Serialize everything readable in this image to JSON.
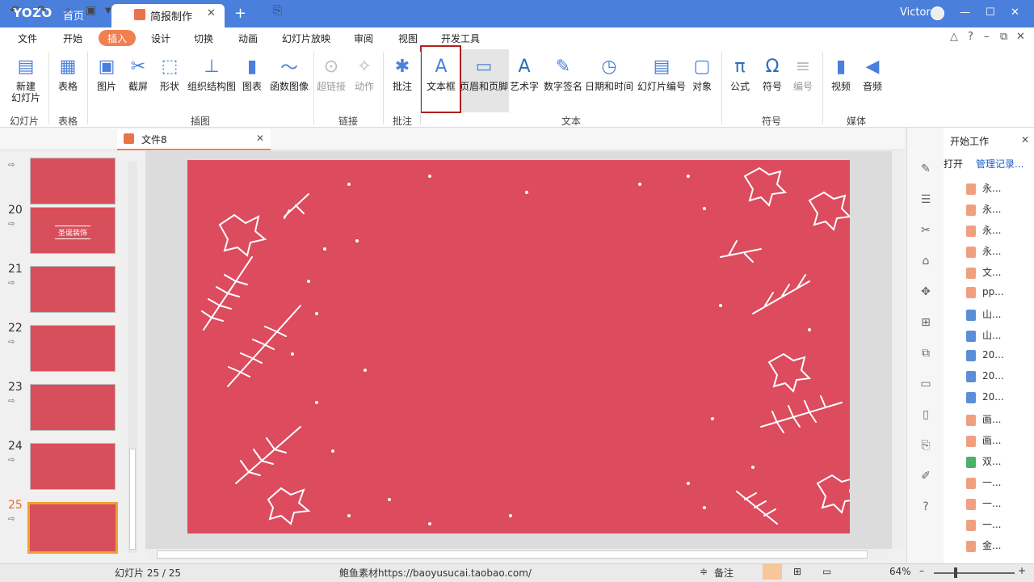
{
  "titlebar": {
    "logo": "YOZO",
    "home": "首页",
    "doc_tab": "简报制作",
    "user": "Victor"
  },
  "menu": [
    "文件",
    "开始",
    "插入",
    "设计",
    "切换",
    "动画",
    "幻灯片放映",
    "审阅",
    "视图",
    "开发工具"
  ],
  "menu_active": "插入",
  "ribbon": {
    "buttons": [
      {
        "label": "新建\n幻灯片",
        "icon": "new-slide-icon",
        "disabled": false
      },
      {
        "label": "表格",
        "icon": "table-icon",
        "disabled": false
      },
      {
        "label": "图片",
        "icon": "picture-icon",
        "disabled": false
      },
      {
        "label": "截屏",
        "icon": "screenshot-icon",
        "disabled": false
      },
      {
        "label": "形状",
        "icon": "shapes-icon",
        "disabled": false
      },
      {
        "label": "组织结构图",
        "icon": "org-chart-icon",
        "disabled": false
      },
      {
        "label": "图表",
        "icon": "chart-icon",
        "disabled": false
      },
      {
        "label": "函数图像",
        "icon": "function-graph-icon",
        "disabled": false
      },
      {
        "label": "超链接",
        "icon": "hyperlink-icon",
        "disabled": true
      },
      {
        "label": "动作",
        "icon": "action-icon",
        "disabled": true
      },
      {
        "label": "批注",
        "icon": "comment-icon",
        "disabled": false
      },
      {
        "label": "文本框",
        "icon": "textbox-icon",
        "disabled": false
      },
      {
        "label": "页眉和页脚",
        "icon": "header-footer-icon",
        "disabled": false
      },
      {
        "label": "艺术字",
        "icon": "wordart-icon",
        "disabled": false
      },
      {
        "label": "数字签名",
        "icon": "signature-icon",
        "disabled": false
      },
      {
        "label": "日期和时间",
        "icon": "datetime-icon",
        "disabled": false
      },
      {
        "label": "幻灯片编号",
        "icon": "slide-number-icon",
        "disabled": false
      },
      {
        "label": "对象",
        "icon": "object-icon",
        "disabled": false
      },
      {
        "label": "公式",
        "icon": "formula-icon",
        "disabled": false
      },
      {
        "label": "符号",
        "icon": "symbol-icon",
        "disabled": false
      },
      {
        "label": "编号",
        "icon": "numbering-icon",
        "disabled": true
      },
      {
        "label": "视频",
        "icon": "video-icon",
        "disabled": false
      },
      {
        "label": "音频",
        "icon": "audio-icon",
        "disabled": false
      }
    ],
    "groups": [
      "幻灯片",
      "表格",
      "插图",
      "链接",
      "批注",
      "文本",
      "符号",
      "媒体"
    ]
  },
  "file_tab": "文件8",
  "thumbnails": [
    {
      "num": "",
      "title": ""
    },
    {
      "num": "20",
      "title": "圣诞装饰"
    },
    {
      "num": "21",
      "title": ""
    },
    {
      "num": "22",
      "title": ""
    },
    {
      "num": "23",
      "title": ""
    },
    {
      "num": "24",
      "title": ""
    },
    {
      "num": "25",
      "title": ""
    }
  ],
  "panel": {
    "title": "开始工作",
    "open": "打开",
    "manage": "管理记录...",
    "files": [
      {
        "name": "永...",
        "type": "p"
      },
      {
        "name": "永...",
        "type": "p"
      },
      {
        "name": "永...",
        "type": "p"
      },
      {
        "name": "永...",
        "type": "p"
      },
      {
        "name": "文...",
        "type": "p"
      },
      {
        "name": "pp...",
        "type": "p"
      },
      {
        "name": "山...",
        "type": "w"
      },
      {
        "name": "山...",
        "type": "w"
      },
      {
        "name": "20...",
        "type": "w"
      },
      {
        "name": "20...",
        "type": "w"
      },
      {
        "name": "20...",
        "type": "w"
      },
      {
        "name": "画...",
        "type": "p"
      },
      {
        "name": "画...",
        "type": "p"
      },
      {
        "name": "双...",
        "type": "x"
      },
      {
        "name": "一...",
        "type": "p"
      },
      {
        "name": "一...",
        "type": "p"
      },
      {
        "name": "一...",
        "type": "p"
      },
      {
        "name": "金...",
        "type": "p"
      }
    ]
  },
  "status": {
    "slide": "幻灯片 25 / 25",
    "source": "鲍鱼素材https://baoyusucai.taobao.com/",
    "notes": "备注",
    "zoom": "64%"
  }
}
